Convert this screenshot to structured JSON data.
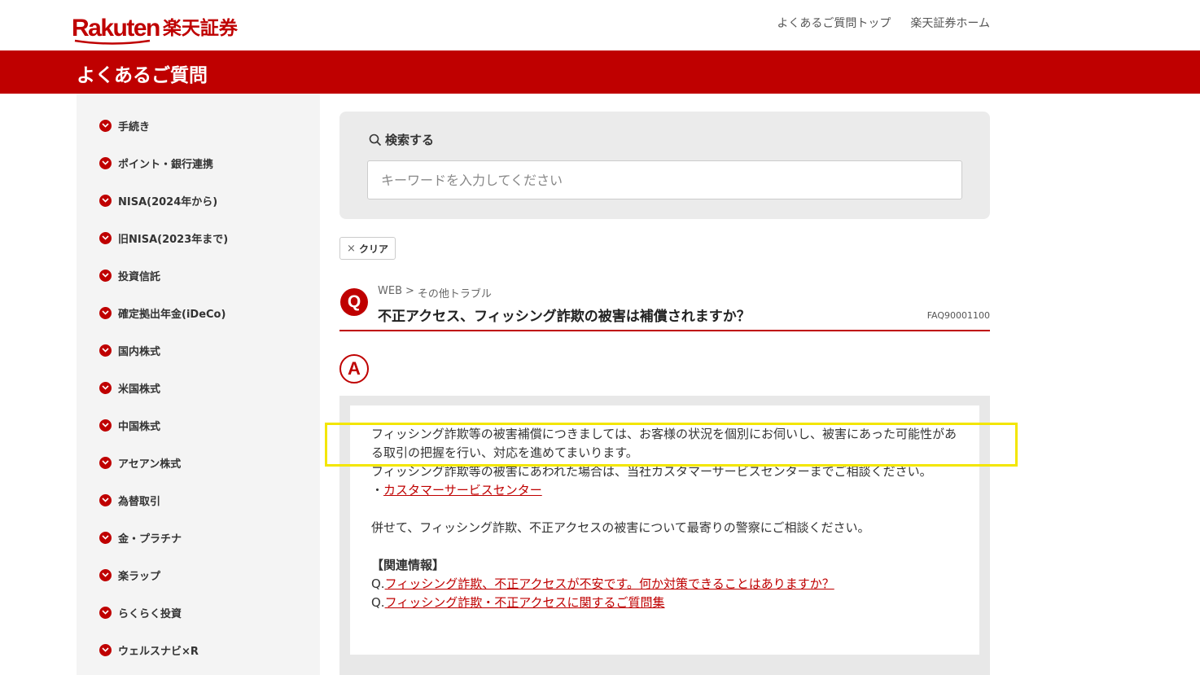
{
  "header": {
    "logo_word": "Rakuten",
    "logo_jp": "楽天証券",
    "links": [
      "よくあるご質問トップ",
      "楽天証券ホーム"
    ],
    "bar_title": "よくあるご質問"
  },
  "sidebar": {
    "items": [
      "手続き",
      "ポイント・銀行連携",
      "NISA(2024年から)",
      "旧NISA(2023年まで)",
      "投資信託",
      "確定拠出年金(iDeCo)",
      "国内株式",
      "米国株式",
      "中国株式",
      "アセアン株式",
      "為替取引",
      "金・プラチナ",
      "楽ラップ",
      "らくらく投資",
      "ウェルスナビ×R"
    ]
  },
  "search": {
    "label": "検索する",
    "placeholder": "キーワードを入力してください",
    "value": "",
    "clear_label": "クリア"
  },
  "question": {
    "badge": "Q",
    "breadcrumb": [
      "WEB",
      ">",
      "その他トラブル"
    ],
    "title": "不正アクセス、フィッシング詐欺の被害は補償されますか？",
    "faq_id": "FAQ90001100"
  },
  "answer": {
    "badge": "A",
    "para1": "フィッシング詐欺等の被害補償につきましては、お客様の状況を個別にお伺いし、被害にあった可能性がある取引の把握を行い、対応を進めてまいります。",
    "para2": "フィッシング詐欺等の被害にあわれた場合は、当社カスタマーサービスセンターまでご相談ください。",
    "bullet_prefix": "・",
    "cs_link": "カスタマーサービスセンター",
    "para3": "併せて、フィッシング詐欺、不正アクセスの被害について最寄りの警察にご相談ください。",
    "related_heading": "【関連情報】",
    "related": [
      {
        "prefix": "Q.",
        "text": "フィッシング詐欺、不正アクセスが不安です。何か対策できることはありますか？"
      },
      {
        "prefix": "Q.",
        "text": "フィッシング詐欺・不正アクセスに関するご質問集"
      }
    ]
  },
  "colors": {
    "brand_red": "#bf0000",
    "highlight_yellow": "#f3e600",
    "sidebar_bg": "#f4f4f4",
    "panel_bg": "#ebebeb"
  }
}
